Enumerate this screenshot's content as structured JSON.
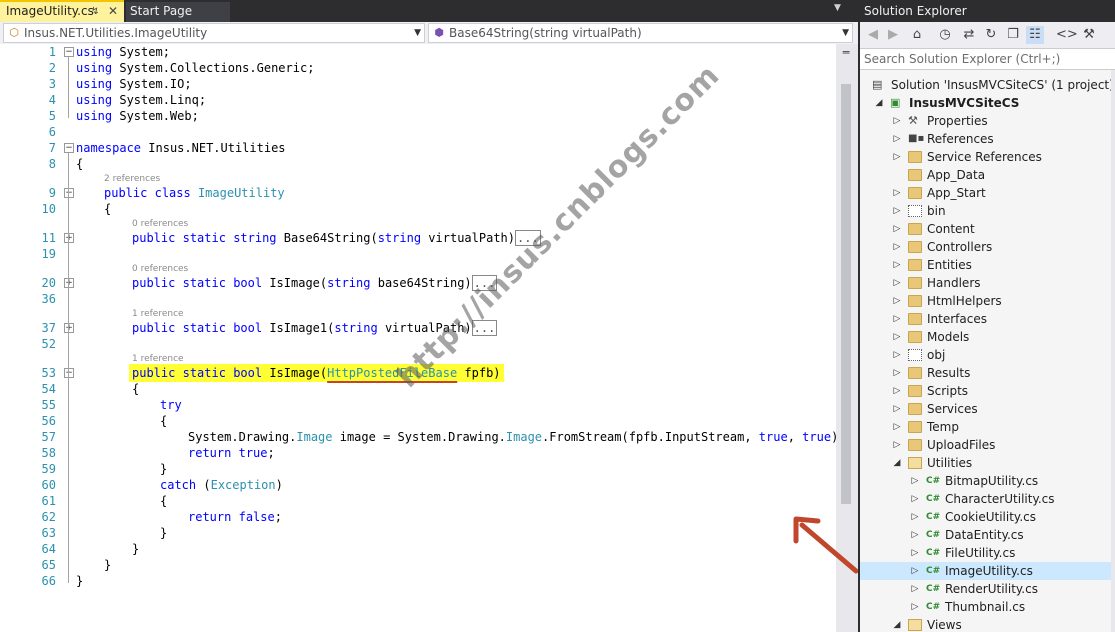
{
  "editor": {
    "tabs": [
      {
        "label": "ImageUtility.cs",
        "active": true
      },
      {
        "label": "Start Page",
        "active": false
      }
    ],
    "nav_class": "Insus.NET.Utilities.ImageUtility",
    "nav_member": "Base64String(string virtualPath)",
    "colors": {
      "keyword": "#0000ff",
      "type": "#2b91af",
      "highlight": "#ffff33",
      "tab_active": "#fff29d",
      "arrow": "#c0472c"
    },
    "code_lines": [
      {
        "n": "1",
        "segs": [
          [
            "kw",
            "using"
          ],
          [
            "",
            "System;"
          ]
        ]
      },
      {
        "n": "2",
        "segs": [
          [
            "kw",
            "using"
          ],
          [
            "",
            "System.Collections.Generic;"
          ]
        ]
      },
      {
        "n": "3",
        "segs": [
          [
            "kw",
            "using"
          ],
          [
            "",
            "System.IO;"
          ]
        ]
      },
      {
        "n": "4",
        "segs": [
          [
            "kw",
            "using"
          ],
          [
            "",
            "System.Linq;"
          ]
        ]
      },
      {
        "n": "5",
        "segs": [
          [
            "kw",
            "using"
          ],
          [
            "",
            "System.Web;"
          ]
        ]
      },
      {
        "n": "6",
        "segs": []
      },
      {
        "n": "7",
        "segs": [
          [
            "kw",
            "namespace"
          ],
          [
            "",
            "Insus.NET.Utilities"
          ]
        ]
      },
      {
        "n": "8",
        "segs": [
          [
            "",
            "{"
          ]
        ]
      },
      {
        "n": "9",
        "lens": "2 references",
        "indent": 1,
        "segs": [
          [
            "kw",
            "public"
          ],
          [
            "kw",
            "class"
          ],
          [
            "ty",
            "ImageUtility"
          ]
        ]
      },
      {
        "n": "10",
        "indent": 1,
        "segs": [
          [
            "",
            "{"
          ]
        ]
      },
      {
        "n": "11",
        "lens": "0 references",
        "indent": 2,
        "collapsed": true,
        "segs": [
          [
            "kw",
            "public"
          ],
          [
            "kw",
            "static"
          ],
          [
            "kw",
            "string"
          ],
          [
            "",
            "Base64String("
          ],
          [
            "kw",
            "string"
          ],
          [
            "",
            "virtualPath)"
          ]
        ]
      },
      {
        "n": "19",
        "segs": []
      },
      {
        "n": "20",
        "lens": "0 references",
        "indent": 2,
        "collapsed": true,
        "segs": [
          [
            "kw",
            "public"
          ],
          [
            "kw",
            "static"
          ],
          [
            "kw",
            "bool"
          ],
          [
            "",
            "IsImage("
          ],
          [
            "kw",
            "string"
          ],
          [
            "",
            "base64String)"
          ]
        ]
      },
      {
        "n": "36",
        "segs": []
      },
      {
        "n": "37",
        "lens": "1 reference",
        "indent": 2,
        "collapsed": true,
        "segs": [
          [
            "kw",
            "public"
          ],
          [
            "kw",
            "static"
          ],
          [
            "kw",
            "bool"
          ],
          [
            "",
            "IsImage1("
          ],
          [
            "kw",
            "string"
          ],
          [
            "",
            "virtualPath)"
          ]
        ]
      },
      {
        "n": "52",
        "segs": []
      },
      {
        "n": "53",
        "lens": "1 reference",
        "indent": 2,
        "highlight": true,
        "segs": [
          [
            "kw",
            "public"
          ],
          [
            "kw",
            "static"
          ],
          [
            "kw",
            "bool"
          ],
          [
            "",
            "IsImage("
          ],
          [
            "ty",
            "HttpPostedFileBase"
          ],
          [
            "",
            "fpfb)"
          ]
        ]
      },
      {
        "n": "54",
        "indent": 2,
        "segs": [
          [
            "",
            "{"
          ]
        ]
      },
      {
        "n": "55",
        "indent": 3,
        "segs": [
          [
            "kw",
            "try"
          ]
        ]
      },
      {
        "n": "56",
        "indent": 3,
        "segs": [
          [
            "",
            "{"
          ]
        ]
      },
      {
        "n": "57",
        "indent": 4,
        "segs": [
          [
            "",
            "System.Drawing."
          ],
          [
            "ty",
            "Image"
          ],
          [
            "",
            "image = System.Drawing."
          ],
          [
            "ty",
            "Image"
          ],
          [
            "",
            ".FromStream(fpfb.InputStream,"
          ],
          [
            "kw",
            "true"
          ],
          [
            "",
            ","
          ],
          [
            "kw",
            "true"
          ],
          [
            "",
            ");"
          ]
        ]
      },
      {
        "n": "58",
        "indent": 4,
        "segs": [
          [
            "kw",
            "return"
          ],
          [
            "kw",
            "true"
          ],
          [
            "",
            ";"
          ]
        ]
      },
      {
        "n": "59",
        "indent": 3,
        "segs": [
          [
            "",
            "}"
          ]
        ]
      },
      {
        "n": "60",
        "indent": 3,
        "segs": [
          [
            "kw",
            "catch"
          ],
          [
            "",
            "("
          ],
          [
            "ty",
            "Exception"
          ],
          [
            "",
            ")"
          ]
        ]
      },
      {
        "n": "61",
        "indent": 3,
        "segs": [
          [
            "",
            "{"
          ]
        ]
      },
      {
        "n": "62",
        "indent": 4,
        "segs": [
          [
            "kw",
            "return"
          ],
          [
            "kw",
            "false"
          ],
          [
            "",
            ";"
          ]
        ]
      },
      {
        "n": "63",
        "indent": 3,
        "segs": [
          [
            "",
            "}"
          ]
        ]
      },
      {
        "n": "64",
        "indent": 2,
        "segs": [
          [
            "",
            "}"
          ]
        ]
      },
      {
        "n": "65",
        "indent": 1,
        "segs": [
          [
            "",
            "}"
          ]
        ]
      },
      {
        "n": "66",
        "segs": [
          [
            "",
            "}"
          ]
        ]
      }
    ],
    "collapsed_marker": "...",
    "watermark": "http://insus.cnblogs.com"
  },
  "solution_explorer": {
    "title": "Solution Explorer",
    "search_placeholder": "Search Solution Explorer (Ctrl+;)",
    "items": [
      {
        "label": "Solution 'InsusMVCSiteCS' (1 project)",
        "level": 0,
        "icon": "solution-icon",
        "exp": ""
      },
      {
        "label": "InsusMVCSiteCS",
        "level": 1,
        "icon": "project-icon",
        "exp": "open",
        "bold": true
      },
      {
        "label": "Properties",
        "level": 2,
        "icon": "wrench-icon",
        "exp": "closed"
      },
      {
        "label": "References",
        "level": 2,
        "icon": "references-icon",
        "exp": "closed"
      },
      {
        "label": "Service References",
        "level": 2,
        "icon": "folder-icon",
        "exp": "closed"
      },
      {
        "label": "App_Data",
        "level": 2,
        "icon": "folder-icon",
        "exp": ""
      },
      {
        "label": "App_Start",
        "level": 2,
        "icon": "folder-icon",
        "exp": "closed"
      },
      {
        "label": "bin",
        "level": 2,
        "icon": "dotted-folder-icon",
        "exp": "closed"
      },
      {
        "label": "Content",
        "level": 2,
        "icon": "folder-icon",
        "exp": "closed"
      },
      {
        "label": "Controllers",
        "level": 2,
        "icon": "folder-icon",
        "exp": "closed"
      },
      {
        "label": "Entities",
        "level": 2,
        "icon": "folder-icon",
        "exp": "closed"
      },
      {
        "label": "Handlers",
        "level": 2,
        "icon": "folder-icon",
        "exp": "closed"
      },
      {
        "label": "HtmlHelpers",
        "level": 2,
        "icon": "folder-icon",
        "exp": "closed"
      },
      {
        "label": "Interfaces",
        "level": 2,
        "icon": "folder-icon",
        "exp": "closed"
      },
      {
        "label": "Models",
        "level": 2,
        "icon": "folder-icon",
        "exp": "closed"
      },
      {
        "label": "obj",
        "level": 2,
        "icon": "dotted-folder-icon",
        "exp": "closed"
      },
      {
        "label": "Results",
        "level": 2,
        "icon": "folder-icon",
        "exp": "closed"
      },
      {
        "label": "Scripts",
        "level": 2,
        "icon": "folder-icon",
        "exp": "closed"
      },
      {
        "label": "Services",
        "level": 2,
        "icon": "folder-icon",
        "exp": "closed"
      },
      {
        "label": "Temp",
        "level": 2,
        "icon": "folder-icon",
        "exp": "closed"
      },
      {
        "label": "UploadFiles",
        "level": 2,
        "icon": "folder-icon",
        "exp": "closed"
      },
      {
        "label": "Utilities",
        "level": 2,
        "icon": "open-folder-icon",
        "exp": "open"
      },
      {
        "label": "BitmapUtility.cs",
        "level": 3,
        "icon": "csharp-file-icon",
        "exp": "closed"
      },
      {
        "label": "CharacterUtility.cs",
        "level": 3,
        "icon": "csharp-file-icon",
        "exp": "closed"
      },
      {
        "label": "CookieUtility.cs",
        "level": 3,
        "icon": "csharp-file-icon",
        "exp": "closed"
      },
      {
        "label": "DataEntity.cs",
        "level": 3,
        "icon": "csharp-file-icon",
        "exp": "closed"
      },
      {
        "label": "FileUtility.cs",
        "level": 3,
        "icon": "csharp-file-icon",
        "exp": "closed"
      },
      {
        "label": "ImageUtility.cs",
        "level": 3,
        "icon": "csharp-file-icon",
        "exp": "closed",
        "selected": true
      },
      {
        "label": "RenderUtility.cs",
        "level": 3,
        "icon": "csharp-file-icon",
        "exp": "closed"
      },
      {
        "label": "Thumbnail.cs",
        "level": 3,
        "icon": "csharp-file-icon",
        "exp": "closed"
      },
      {
        "label": "Views",
        "level": 2,
        "icon": "open-folder-icon",
        "exp": "open"
      }
    ],
    "toolbar_icons": [
      "back-icon",
      "forward-icon",
      "home-icon",
      "history-icon",
      "sync-icon",
      "refresh-icon",
      "collapse-all-icon",
      "show-all-files-icon",
      "view-code-icon",
      "properties-icon"
    ]
  }
}
